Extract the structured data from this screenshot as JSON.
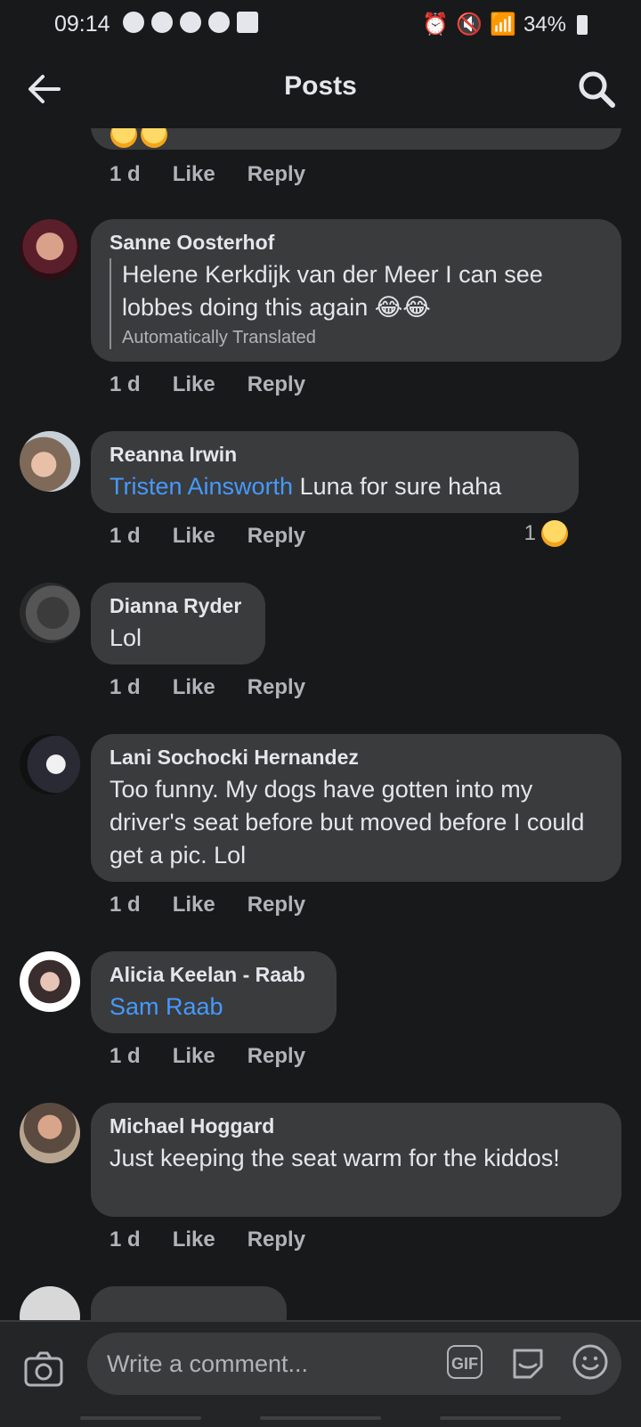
{
  "status_bar": {
    "time": "09:14",
    "battery": "34%"
  },
  "header": {
    "title": "Posts"
  },
  "comments": [
    {
      "partial": true,
      "time": "1 d",
      "like": "Like",
      "reply": "Reply"
    },
    {
      "author": "Sanne Oosterhof",
      "text": "Helene Kerkdijk van der Meer I can see lobbes doing this again 😂😂",
      "translated_note": "Automatically Translated",
      "time": "1 d",
      "like": "Like",
      "reply": "Reply"
    },
    {
      "author": "Reanna Irwin",
      "mention": "Tristen Ainsworth",
      "text": " Luna for sure haha",
      "time": "1 d",
      "like": "Like",
      "reply": "Reply",
      "reaction_count": "1"
    },
    {
      "author": "Dianna Ryder",
      "text": "Lol",
      "time": "1 d",
      "like": "Like",
      "reply": "Reply"
    },
    {
      "author": "Lani Sochocki Hernandez",
      "text": "Too funny. My dogs have gotten into my driver's seat before but moved before I could get a pic. Lol",
      "time": "1 d",
      "like": "Like",
      "reply": "Reply"
    },
    {
      "author": "Alicia Keelan - Raab",
      "mention": "Sam Raab",
      "time": "1 d",
      "like": "Like",
      "reply": "Reply"
    },
    {
      "author": "Michael Hoggard",
      "text": "Just keeping the seat warm for the kiddos!",
      "time": "1 d",
      "like": "Like",
      "reply": "Reply"
    }
  ],
  "composer": {
    "placeholder": "Write a comment...",
    "gif_label": "GIF"
  },
  "icons": {
    "back": "arrow-left-icon",
    "search": "search-icon",
    "camera": "camera-icon",
    "sticker": "sticker-icon",
    "emoji": "smiley-icon"
  },
  "colors": {
    "background": "#18191a",
    "bubble": "#3a3b3c",
    "mention": "#4599ff",
    "secondary_text": "#b0b3b8"
  }
}
